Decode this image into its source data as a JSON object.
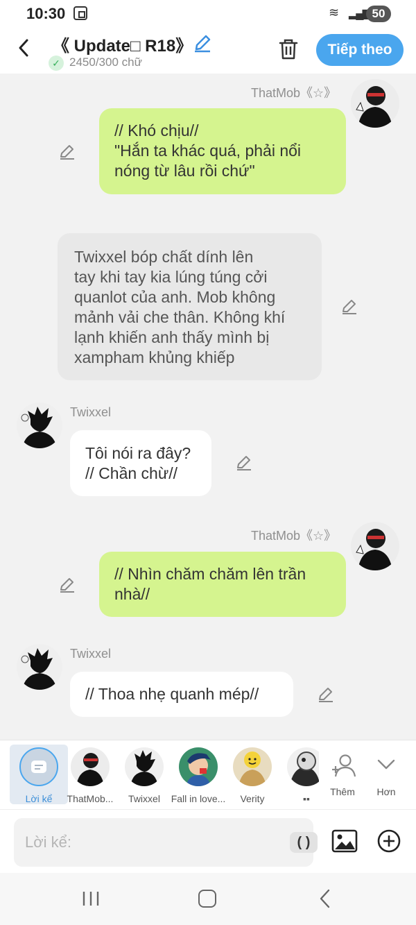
{
  "status": {
    "time": "10:30",
    "battery": "50"
  },
  "header": {
    "title": "《 Update□ R18》",
    "word_count": "2450/300 chữ",
    "next_label": "Tiếp theo"
  },
  "messages": [
    {
      "speaker": "ThatMob《☆》",
      "side": "right",
      "style": "green",
      "lines": [
        "// Khó chịu//",
        "\"Hắn ta khác quá, phải nổi",
        "nóng từ lâu rồi chứ\""
      ]
    },
    {
      "speaker": "",
      "side": "narration",
      "style": "gray",
      "lines": [
        "Twixxel bóp chất dính lên",
        "tay khi tay kia lúng túng cởi",
        "quanlot của anh. Mob không",
        "mảnh vải che thân. Không khí",
        "lạnh khiến anh thấy mình bị",
        "xampham khủng khiếp"
      ]
    },
    {
      "speaker": "Twixxel",
      "side": "left",
      "style": "white",
      "lines": [
        "Tôi nói ra đây?",
        "// Chần chừ//"
      ]
    },
    {
      "speaker": "ThatMob《☆》",
      "side": "right",
      "style": "green",
      "lines": [
        "// Nhìn chăm chăm lên trần",
        "nhà//"
      ]
    },
    {
      "speaker": "Twixxel",
      "side": "left",
      "style": "white",
      "lines": [
        "// Thoa nhẹ quanh mép//"
      ]
    }
  ],
  "characters": [
    {
      "label": "Lời kể",
      "icon": "narration-icon",
      "selected": true
    },
    {
      "label": "ThatMob...",
      "icon": "avatar"
    },
    {
      "label": "Twixxel",
      "icon": "avatar"
    },
    {
      "label": "Fall in love...",
      "icon": "avatar"
    },
    {
      "label": "Verity",
      "icon": "avatar"
    },
    {
      "label": "▪▪",
      "icon": "avatar"
    }
  ],
  "actions": {
    "add_label": "Thêm",
    "more_label": "Hơn"
  },
  "input": {
    "placeholder": "Lời kể:",
    "paren_label": "( )"
  },
  "colors": {
    "accent": "#4aa6ee",
    "green_bubble": "#d5f48f",
    "narration_bubble": "#e8e8e8"
  }
}
